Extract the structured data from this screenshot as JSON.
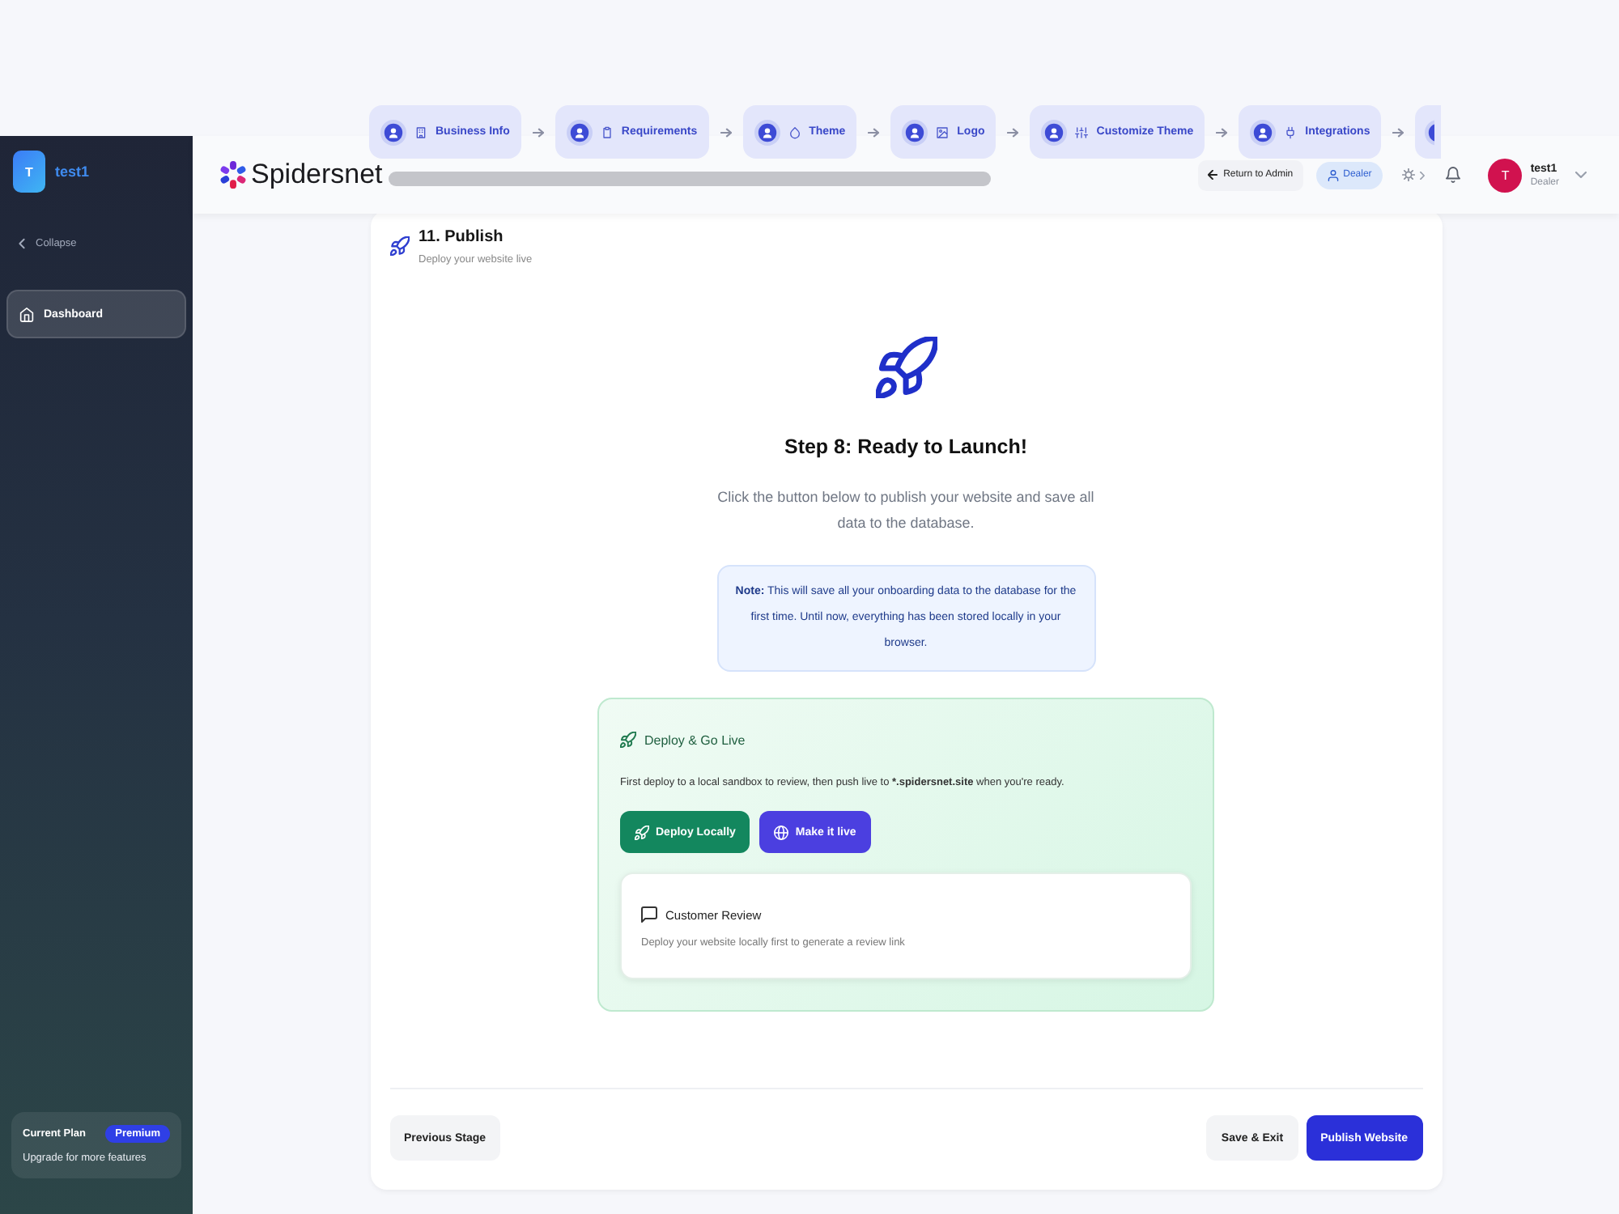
{
  "sidebar": {
    "avatar_initial": "T",
    "workspace": "test1",
    "collapse": "Collapse",
    "items": [
      {
        "label": "Dashboard",
        "selected": true
      }
    ],
    "plan": {
      "label": "Current Plan",
      "badge": "Premium",
      "note": "Upgrade for more features"
    }
  },
  "header": {
    "brand": "Spidersnet",
    "steps": [
      {
        "kind": "step",
        "label": "Business Info"
      },
      {
        "kind": "step",
        "label": "Requirements"
      },
      {
        "kind": "step",
        "label": "Theme"
      },
      {
        "kind": "step",
        "label": "Logo"
      },
      {
        "kind": "step",
        "label": "Customize Theme"
      },
      {
        "kind": "step",
        "label": "Integrations"
      },
      {
        "kind": "partial"
      }
    ],
    "return_button": "Return to Admin",
    "role_badge": "Dealer",
    "user": {
      "initial": "T",
      "name": "test1",
      "role": "Dealer"
    }
  },
  "page": {
    "step_title": "11. Publish",
    "step_subtitle": "Deploy your website live",
    "heading": "Step 8: Ready to Launch!",
    "intro": "Click the button below to publish your website and save all data to the database.",
    "note": "**Note:** This will save all your onboarding data to the database for the first time. Until now, everything has been stored locally in your browser.",
    "deploy_panel": {
      "title": "Deploy & Go Live",
      "description": [
        {
          "text": "First deploy to a local sandbox to review, then push live to ",
          "bold": false
        },
        {
          "text": "*.spidersnet.site",
          "bold": true
        },
        {
          "text": " when you're ready.",
          "bold": false
        }
      ],
      "buttons": [
        {
          "kind": "local",
          "label": "Deploy Locally"
        },
        {
          "kind": "live",
          "label": "Make it live"
        }
      ],
      "review": {
        "title": "Customer Review",
        "text": "Deploy your website locally first to generate a review link"
      }
    }
  },
  "footer": {
    "back_button": "Previous Stage",
    "buttons": [
      {
        "kind": "secondary",
        "label": "Save & Exit"
      },
      {
        "kind": "primary",
        "label": "Publish Website"
      }
    ]
  }
}
